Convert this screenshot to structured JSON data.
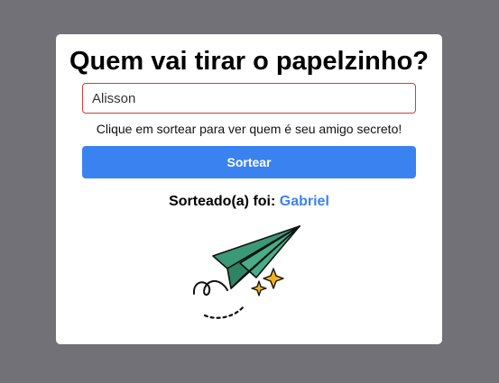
{
  "card": {
    "title": "Quem vai tirar o papelzinho?",
    "input": {
      "value": "Alisson",
      "border_color": "#d9393e"
    },
    "hint": "Clique em sortear para ver quem é seu amigo secreto!",
    "draw_button_label": "Sortear",
    "result": {
      "label": "Sorteado(a) foi:",
      "winner": "Gabriel"
    },
    "illustration": "paper-plane-icon"
  },
  "colors": {
    "background": "#717177",
    "accent": "#3b82f1",
    "plane": "#3a9a78"
  }
}
